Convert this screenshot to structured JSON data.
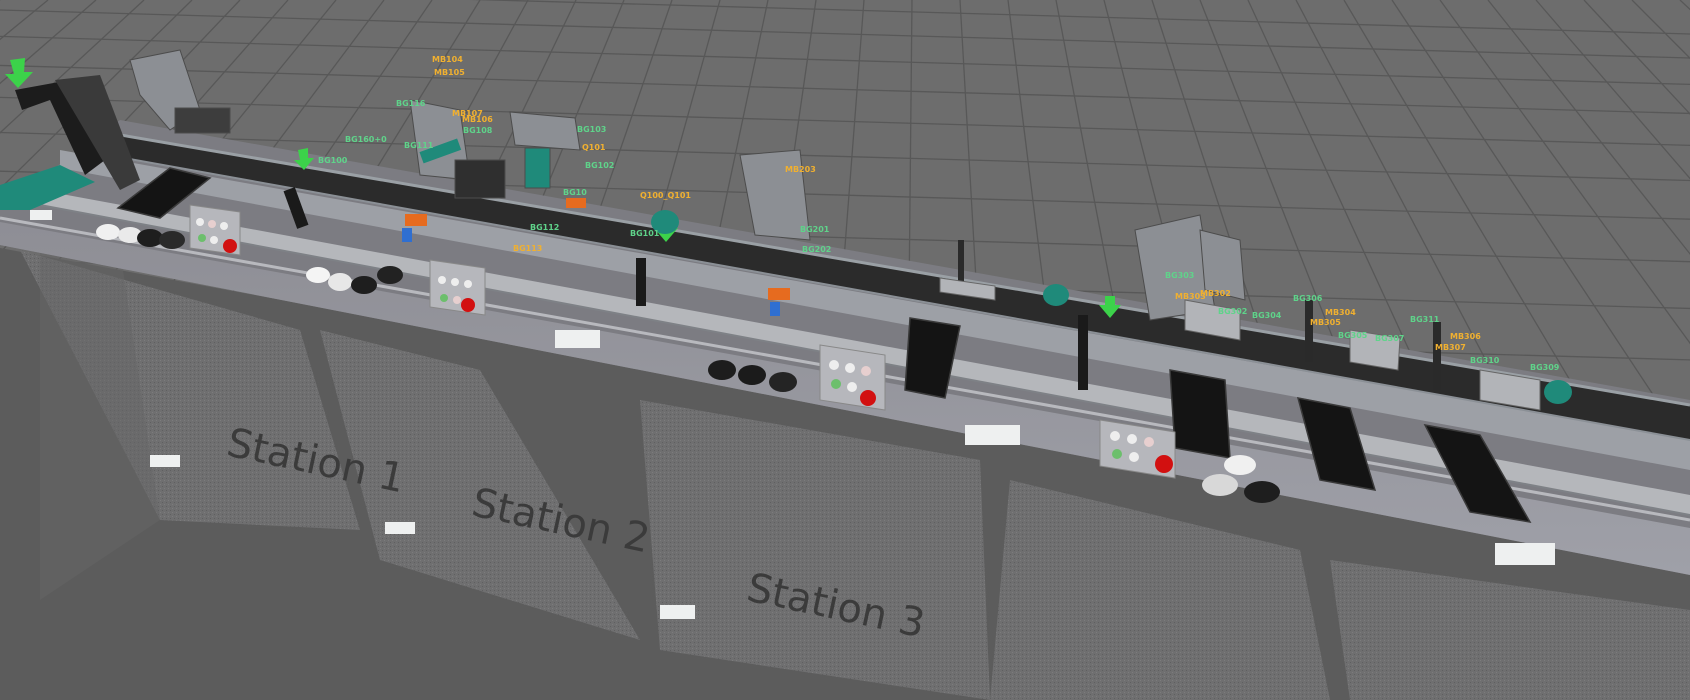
{
  "colors": {
    "floor": "#6d6d6d",
    "grid_line": "#555555",
    "table_leg": "#6a6a6a",
    "conveyor_belt": "#2b2b2b",
    "aluminium": "#a9acb0",
    "sensor_label_green": "#5fd38a",
    "sensor_label_orange": "#f0b030",
    "stop_button": "#d21010",
    "teal_part": "#1f8a7a"
  },
  "stations": [
    {
      "label": "Station 1"
    },
    {
      "label": "Station 2"
    },
    {
      "label": "Station 3"
    }
  ],
  "tags": [
    {
      "text": "MB104",
      "tone": "orange"
    },
    {
      "text": "MB105",
      "tone": "orange"
    },
    {
      "text": "BG116",
      "tone": "green"
    },
    {
      "text": "MB107",
      "tone": "orange"
    },
    {
      "text": "MB106",
      "tone": "orange"
    },
    {
      "text": "BG108",
      "tone": "green"
    },
    {
      "text": "BG160+0",
      "tone": "green"
    },
    {
      "text": "BG111",
      "tone": "green"
    },
    {
      "text": "BG103",
      "tone": "green"
    },
    {
      "text": "Q101",
      "tone": "orange"
    },
    {
      "text": "BG102",
      "tone": "green"
    },
    {
      "text": "BG10",
      "tone": "green"
    },
    {
      "text": "BG100",
      "tone": "green"
    },
    {
      "text": "Q100_Q101",
      "tone": "orange"
    },
    {
      "text": "BG112",
      "tone": "green"
    },
    {
      "text": "BG113",
      "tone": "orange"
    },
    {
      "text": "BG101",
      "tone": "green"
    },
    {
      "text": "MB203",
      "tone": "orange"
    },
    {
      "text": "BG201",
      "tone": "green"
    },
    {
      "text": "BG202",
      "tone": "green"
    },
    {
      "text": "BG303",
      "tone": "green"
    },
    {
      "text": "MB302",
      "tone": "orange"
    },
    {
      "text": "MB303",
      "tone": "orange"
    },
    {
      "text": "BG302",
      "tone": "green"
    },
    {
      "text": "BG304",
      "tone": "green"
    },
    {
      "text": "BG306",
      "tone": "green"
    },
    {
      "text": "MB304",
      "tone": "orange"
    },
    {
      "text": "MB305",
      "tone": "orange"
    },
    {
      "text": "BG305",
      "tone": "green"
    },
    {
      "text": "BG307",
      "tone": "green"
    },
    {
      "text": "BG311",
      "tone": "green"
    },
    {
      "text": "MB306",
      "tone": "orange"
    },
    {
      "text": "MB307",
      "tone": "orange"
    },
    {
      "text": "BG310",
      "tone": "green"
    },
    {
      "text": "BG309",
      "tone": "green"
    }
  ]
}
